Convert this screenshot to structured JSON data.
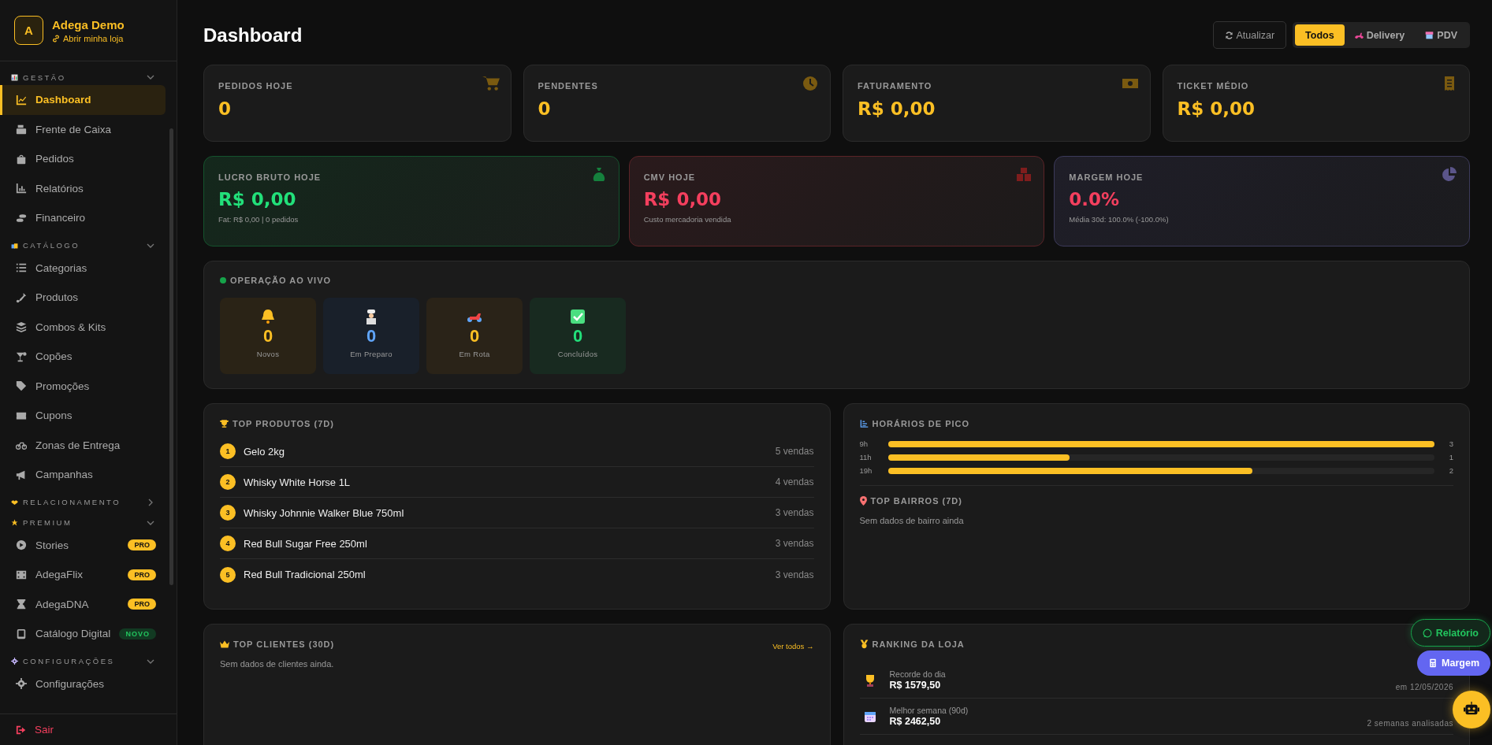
{
  "brand": {
    "initial": "A",
    "name": "Adega Demo",
    "link": "Abrir minha loja"
  },
  "sidebar": {
    "groups": [
      {
        "label": "GESTÃO",
        "expanded": true,
        "items": [
          {
            "label": "Dashboard",
            "selected": true
          },
          {
            "label": "Frente de Caixa",
            "selected": false
          },
          {
            "label": "Pedidos",
            "selected": false
          },
          {
            "label": "Relatórios",
            "selected": false
          },
          {
            "label": "Financeiro",
            "selected": false
          }
        ]
      },
      {
        "label": "CATÁLOGO",
        "expanded": true,
        "items": [
          {
            "label": "Categorias",
            "selected": false
          },
          {
            "label": "Produtos",
            "selected": false
          },
          {
            "label": "Combos & Kits",
            "selected": false
          },
          {
            "label": "Copões",
            "selected": false
          },
          {
            "label": "Promoções",
            "selected": false
          },
          {
            "label": "Cupons",
            "selected": false
          },
          {
            "label": "Zonas de Entrega",
            "selected": false
          },
          {
            "label": "Campanhas",
            "selected": false
          }
        ]
      },
      {
        "label": "RELACIONAMENTO",
        "expanded": false
      },
      {
        "label": "PREMIUM",
        "expanded": true,
        "items": [
          {
            "label": "Stories",
            "selected": false,
            "badge": "PRO",
            "kind": "pro"
          },
          {
            "label": "AdegaFlix",
            "selected": false,
            "badge": "PRO",
            "kind": "pro"
          },
          {
            "label": "AdegaDNA",
            "selected": false,
            "badge": "PRO",
            "kind": "pro"
          },
          {
            "label": "Catálogo Digital",
            "selected": false,
            "badge": "NOVO",
            "kind": "new"
          }
        ]
      },
      {
        "label": "CONFIGURAÇÕES",
        "expanded": true,
        "items": [
          {
            "label": "Configurações",
            "selected": false
          }
        ]
      }
    ],
    "logout": "Sair"
  },
  "header": {
    "title": "Dashboard",
    "refresh": "Atualizar",
    "channels": [
      {
        "label": "Todos",
        "selected": true
      },
      {
        "label": "Delivery",
        "selected": false
      },
      {
        "label": "PDV",
        "selected": false
      }
    ]
  },
  "kpis": [
    {
      "label": "PEDIDOS HOJE",
      "value": "0"
    },
    {
      "label": "PENDENTES",
      "value": "0"
    },
    {
      "label": "FATURAMENTO",
      "value": "R$ 0,00"
    },
    {
      "label": "TICKET MÉDIO",
      "value": "R$ 0,00"
    }
  ],
  "profit_cards": [
    {
      "kind": "profit",
      "label": "LUCRO BRUTO HOJE",
      "value": "R$ 0,00",
      "note": "Fat: R$ 0,00 | 0 pedidos"
    },
    {
      "kind": "cost",
      "label": "CMV HOJE",
      "value": "R$ 0,00",
      "note": "Custo mercadoria vendida"
    },
    {
      "kind": "margin",
      "label": "MARGEM HOJE",
      "value": "0.0%",
      "note": "Média 30d: 100.0% (-100.0%)"
    }
  ],
  "live": {
    "title": "OPERAÇÃO AO VIVO",
    "stages": [
      {
        "kind": "new",
        "value": "0",
        "label": "Novos"
      },
      {
        "kind": "preparing",
        "value": "0",
        "label": "Em Preparo"
      },
      {
        "kind": "route",
        "value": "0",
        "label": "Em Rota"
      },
      {
        "kind": "done",
        "value": "0",
        "label": "Concluídos"
      }
    ]
  },
  "top_products": {
    "title": "TOP PRODUTOS (7D)",
    "items": [
      {
        "rank": "1",
        "name": "Gelo 2kg",
        "sales": "5 vendas"
      },
      {
        "rank": "2",
        "name": "Whisky White Horse 1L",
        "sales": "4 vendas"
      },
      {
        "rank": "3",
        "name": "Whisky Johnnie Walker Blue 750ml",
        "sales": "3 vendas"
      },
      {
        "rank": "4",
        "name": "Red Bull Sugar Free 250ml",
        "sales": "3 vendas"
      },
      {
        "rank": "5",
        "name": "Red Bull Tradicional 250ml",
        "sales": "3 vendas"
      }
    ]
  },
  "peak_hours": {
    "title": "HORÁRIOS DE PICO",
    "rows": [
      {
        "hour": "9h",
        "level": 1,
        "count": "3"
      },
      {
        "hour": "11h",
        "level": 0.333,
        "count": "1"
      },
      {
        "hour": "19h",
        "level": 0.667,
        "count": "2"
      }
    ]
  },
  "neighborhoods": {
    "title": "TOP BAIRROS (7D)",
    "empty": "Sem dados de bairro ainda"
  },
  "top_clients": {
    "title": "TOP CLIENTES (30D)",
    "link": "Ver todos →",
    "empty": "Sem dados de clientes ainda."
  },
  "ranking": {
    "title": "RANKING DA LOJA",
    "rows": [
      {
        "label": "Recorde do dia",
        "value": "R$ 1579,50",
        "note": "em 12/05/2026"
      },
      {
        "label": "Melhor semana (90d)",
        "value": "R$ 2462,50",
        "note": "2 semanas analisadas"
      }
    ]
  },
  "floating": [
    {
      "kind": "report",
      "label": "Relatório"
    },
    {
      "kind": "margin",
      "label": "Margem"
    },
    {
      "kind": "assistant"
    }
  ]
}
